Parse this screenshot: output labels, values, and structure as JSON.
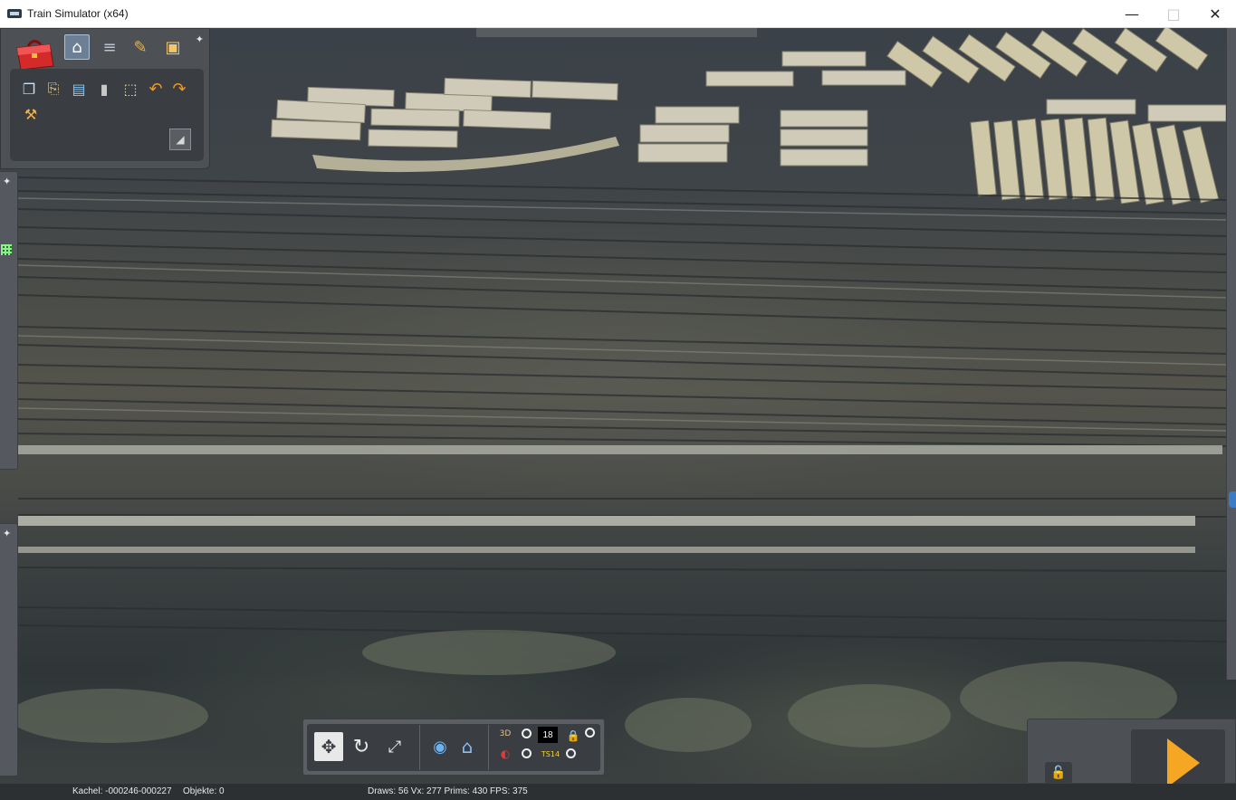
{
  "window": {
    "title": "Train Simulator (x64)",
    "minimize_glyph": "—",
    "maximize_glyph": "□",
    "close_glyph": "✕"
  },
  "toolbox": {
    "tabs": [
      {
        "icon": "home-icon",
        "active": true
      },
      {
        "icon": "track-icon",
        "active": false
      },
      {
        "icon": "paintbrush-icon",
        "active": false
      },
      {
        "icon": "train-icon",
        "active": false
      }
    ],
    "tools": [
      "copy-icon",
      "paste-icon",
      "monitor-icon",
      "trash-icon",
      "zoom-area-icon",
      "undo-icon",
      "redo-icon",
      "measure-icon"
    ],
    "colors": {
      "panel": "#4d5156",
      "inner": "#3a3d41",
      "active_tab": "#6c7f94"
    }
  },
  "controls": {
    "badge_value": "18",
    "label_3d": "3D",
    "label_ts": "TS14"
  },
  "status": {
    "tile": "Kachel: -000246-000227",
    "objects": "Objekte: 0",
    "perf": "Draws: 56 Vx: 277 Prims: 430 FPS: 375"
  },
  "colors": {
    "play": "#f5a623",
    "accent_blue": "#3b7cc5"
  }
}
